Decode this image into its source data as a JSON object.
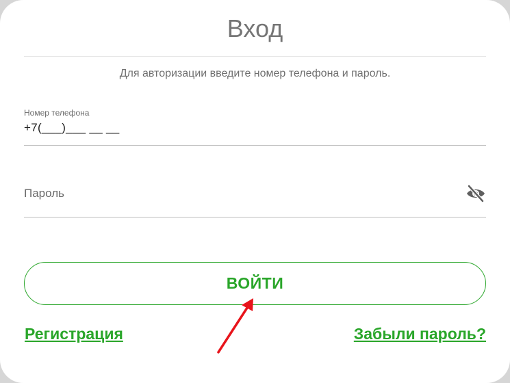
{
  "login": {
    "title": "Вход",
    "subtitle": "Для авторизации введите номер телефона и пароль.",
    "phone": {
      "label": "Номер телефона",
      "value": "+7(___)___ __ __"
    },
    "password": {
      "label": "Пароль",
      "toggle_icon": "eye-slash-icon"
    },
    "submit_label": "ВОЙТИ",
    "register_link": "Регистрация",
    "forgot_link": "Забыли пароль?"
  },
  "colors": {
    "accent": "#2aa62a",
    "annotation_arrow": "#e8141b",
    "text_muted": "#6f6f6f"
  }
}
